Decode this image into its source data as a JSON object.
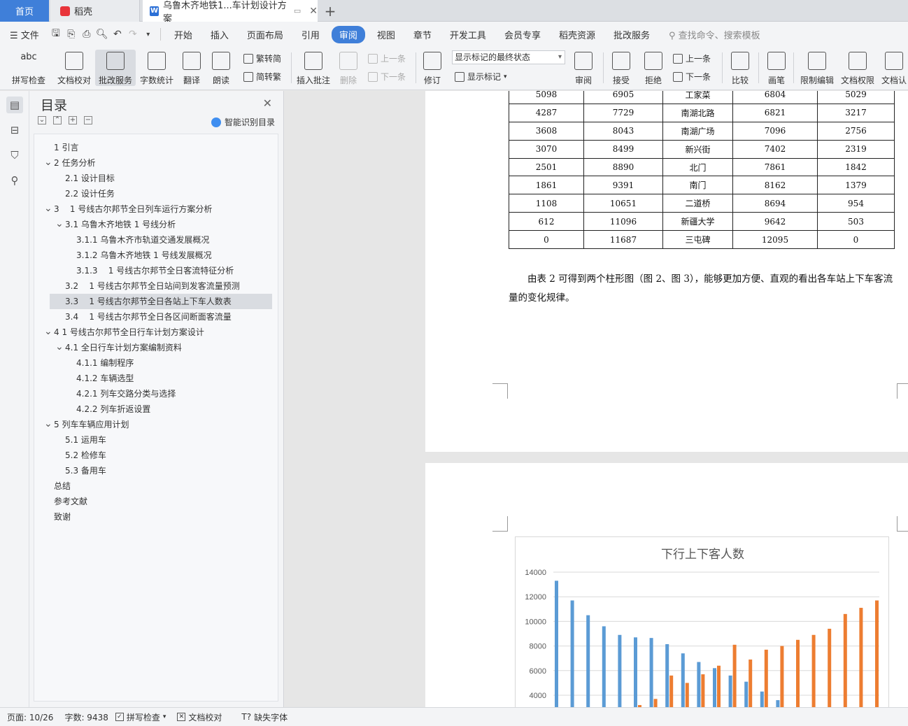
{
  "tabs": {
    "home": "首页",
    "daoke": "稻壳",
    "doc": "乌鲁木齐地铁1...车计划设计方案",
    "add": "+"
  },
  "menu": {
    "file": "文件",
    "items": [
      "开始",
      "插入",
      "页面布局",
      "引用",
      "审阅",
      "视图",
      "章节",
      "开发工具",
      "会员专享",
      "稻壳资源",
      "批改服务"
    ],
    "active_index": 4,
    "search": "查找命令、搜索模板"
  },
  "ribbon": {
    "spell": "拼写检查",
    "proofread": "文档校对",
    "correct": "批改服务",
    "wordcount": "字数统计",
    "translate": "翻译",
    "read": "朗读",
    "trad": "繁转简",
    "simp": "简转繁",
    "insert_comment": "插入批注",
    "delete": "删除",
    "prev": "上一条",
    "next": "下一条",
    "revise": "修订",
    "display_state": "显示标记的最终状态",
    "show_marks": "显示标记",
    "review": "审阅",
    "accept": "接受",
    "reject": "拒绝",
    "prev2": "上一条",
    "next2": "下一条",
    "compare": "比较",
    "pen": "画笔",
    "restrict": "限制编辑",
    "perm": "文档权限",
    "cert": "文档认"
  },
  "toc": {
    "title": "目录",
    "smart": "智能识别目录",
    "items": [
      {
        "text": "1 引言",
        "level": 0,
        "arrow": false
      },
      {
        "text": "2 任务分析",
        "level": 0,
        "arrow": true
      },
      {
        "text": "2.1 设计目标",
        "level": 1,
        "arrow": false
      },
      {
        "text": "2.2 设计任务",
        "level": 1,
        "arrow": false
      },
      {
        "text": "3    1 号线古尔邦节全日列车运行方案分析",
        "level": 0,
        "arrow": true
      },
      {
        "text": "3.1 乌鲁木齐地铁 1 号线分析",
        "level": 1,
        "arrow": true
      },
      {
        "text": "3.1.1 乌鲁木齐市轨道交通发展概况",
        "level": 2,
        "arrow": false
      },
      {
        "text": "3.1.2 乌鲁木齐地铁 1 号线发展概况",
        "level": 2,
        "arrow": false
      },
      {
        "text": "3.1.3    1 号线古尔邦节全日客流特征分析",
        "level": 2,
        "arrow": false
      },
      {
        "text": "3.2    1 号线古尔邦节全日站间到发客流量预测",
        "level": 1,
        "arrow": false
      },
      {
        "text": "3.3    1 号线古尔邦节全日各站上下车人数表",
        "level": 1,
        "arrow": false,
        "selected": true
      },
      {
        "text": "3.4    1 号线古尔邦节全日各区间断面客流量",
        "level": 1,
        "arrow": false
      },
      {
        "text": "4 1 号线古尔邦节全日行车计划方案设计",
        "level": 0,
        "arrow": true
      },
      {
        "text": "4.1 全日行车计划方案编制资料",
        "level": 1,
        "arrow": true
      },
      {
        "text": "4.1.1 编制程序",
        "level": 2,
        "arrow": false
      },
      {
        "text": "4.1.2 车辆选型",
        "level": 2,
        "arrow": false
      },
      {
        "text": "4.2.1 列车交路分类与选择",
        "level": 2,
        "arrow": false
      },
      {
        "text": "4.2.2 列车折返设置",
        "level": 2,
        "arrow": false
      },
      {
        "text": "5 列车车辆应用计划",
        "level": 0,
        "arrow": true
      },
      {
        "text": "5.1 运用车",
        "level": 1,
        "arrow": false
      },
      {
        "text": "5.2 检修车",
        "level": 1,
        "arrow": false
      },
      {
        "text": "5.3 备用车",
        "level": 1,
        "arrow": false
      },
      {
        "text": "总结",
        "level": 0,
        "arrow": false
      },
      {
        "text": "参考文献",
        "level": 0,
        "arrow": false
      },
      {
        "text": "致谢",
        "level": 0,
        "arrow": false
      }
    ]
  },
  "table": {
    "rows": [
      [
        "5098",
        "6905",
        "工家菜",
        "6804",
        "5029"
      ],
      [
        "4287",
        "7729",
        "南湖北路",
        "6821",
        "3217"
      ],
      [
        "3608",
        "8043",
        "南湖广场",
        "7096",
        "2756"
      ],
      [
        "3070",
        "8499",
        "新兴街",
        "7402",
        "2319"
      ],
      [
        "2501",
        "8890",
        "北门",
        "7861",
        "1842"
      ],
      [
        "1861",
        "9391",
        "南门",
        "8162",
        "1379"
      ],
      [
        "1108",
        "10651",
        "二道桥",
        "8694",
        "954"
      ],
      [
        "612",
        "11096",
        "新疆大学",
        "9642",
        "503"
      ],
      [
        "0",
        "11687",
        "三屯碑",
        "12095",
        "0"
      ]
    ]
  },
  "paragraph": "由表 2 可得到两个柱形图（图 2、图 3），能够更加方便、直观的看出各车站上下车客流量的变化规律。",
  "chart_data": {
    "type": "bar",
    "title": "下行上下客人数",
    "ylim": [
      4000,
      14000
    ],
    "yticks": [
      "14000",
      "12000",
      "10000",
      "8000",
      "6000",
      "4000"
    ],
    "series": [
      {
        "color": "#5b9bd5",
        "values": [
          13300,
          11700,
          10500,
          9600,
          8900,
          8700,
          8650,
          8150,
          7400,
          6700,
          6200,
          5600,
          5100,
          4300,
          3600,
          0,
          0,
          0,
          0,
          0,
          0
        ]
      },
      {
        "color": "#ed7d31",
        "values": [
          0,
          0,
          0,
          0,
          0,
          3200,
          3700,
          5600,
          5000,
          5700,
          6400,
          8100,
          6900,
          7700,
          8000,
          8500,
          8900,
          9400,
          10600,
          11100,
          11700
        ]
      }
    ],
    "grid": true
  },
  "status": {
    "page": "页面: 10/26",
    "words": "字数: 9438",
    "spell": "拼写检查",
    "proof": "文档校对",
    "missing_font": "缺失字体"
  }
}
